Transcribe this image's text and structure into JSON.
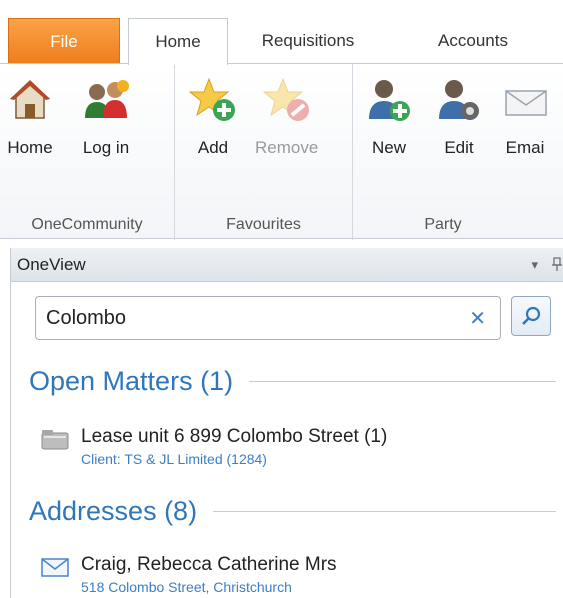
{
  "ribbon": {
    "tabs": [
      {
        "label": "File"
      },
      {
        "label": "Home"
      },
      {
        "label": "Requisitions"
      },
      {
        "label": "Accounts"
      }
    ],
    "groups": {
      "onecommunity": {
        "label": "OneCommunity",
        "buttons": [
          {
            "label": "Home",
            "icon": "house-icon"
          },
          {
            "label": "Log in",
            "icon": "users-icon"
          }
        ]
      },
      "favourites": {
        "label": "Favourites",
        "buttons": [
          {
            "label": "Add",
            "icon": "star-add-icon"
          },
          {
            "label": "Remove",
            "icon": "star-remove-icon",
            "disabled": true
          }
        ]
      },
      "party": {
        "label": "Party",
        "buttons": [
          {
            "label": "New",
            "icon": "person-add-icon"
          },
          {
            "label": "Edit",
            "icon": "person-edit-icon"
          },
          {
            "label": "Emai",
            "icon": "email-icon"
          }
        ]
      }
    }
  },
  "oneview": {
    "title": "OneView",
    "search": {
      "value": "Colombo"
    },
    "sections": {
      "open_matters": {
        "heading": "Open Matters (1)",
        "items": [
          {
            "title": "Lease unit 6 899 Colombo Street  (1)",
            "subtitle": "Client: TS & JL Limited (1284)"
          }
        ]
      },
      "addresses": {
        "heading": "Addresses (8)",
        "items": [
          {
            "title": "Craig, Rebecca Catherine Mrs",
            "subtitle": "518 Colombo Street, Christchurch"
          }
        ]
      }
    }
  },
  "colors": {
    "file_tab": "#ef7d1d",
    "accent_blue": "#2f77ba",
    "link_blue": "#3b7fc4"
  }
}
